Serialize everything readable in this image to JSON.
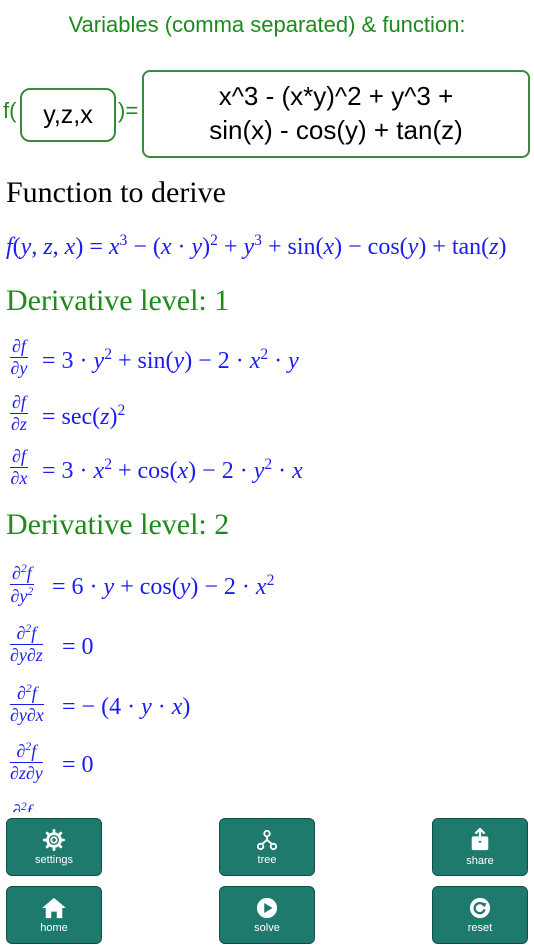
{
  "header": {
    "title": "Variables (comma separated) & function:"
  },
  "inputs": {
    "prefix": "f(",
    "variables": "y,z,x",
    "suffix": ")=",
    "function_line1": "x^3 - (x*y)^2 + y^3 +",
    "function_line2": "sin(x) - cos(y) + tan(z)"
  },
  "results": {
    "heading": "Function to derive",
    "level1_title": "Derivative level: 1",
    "level2_title": "Derivative level: 2"
  },
  "toolbar": {
    "settings": "settings",
    "tree": "tree",
    "share": "share",
    "home": "home",
    "solve": "solve",
    "reset": "reset"
  },
  "colors": {
    "accent_green": "#1e8a1e",
    "math_blue": "#1c1cf0",
    "button_teal": "#1f7a6e"
  }
}
